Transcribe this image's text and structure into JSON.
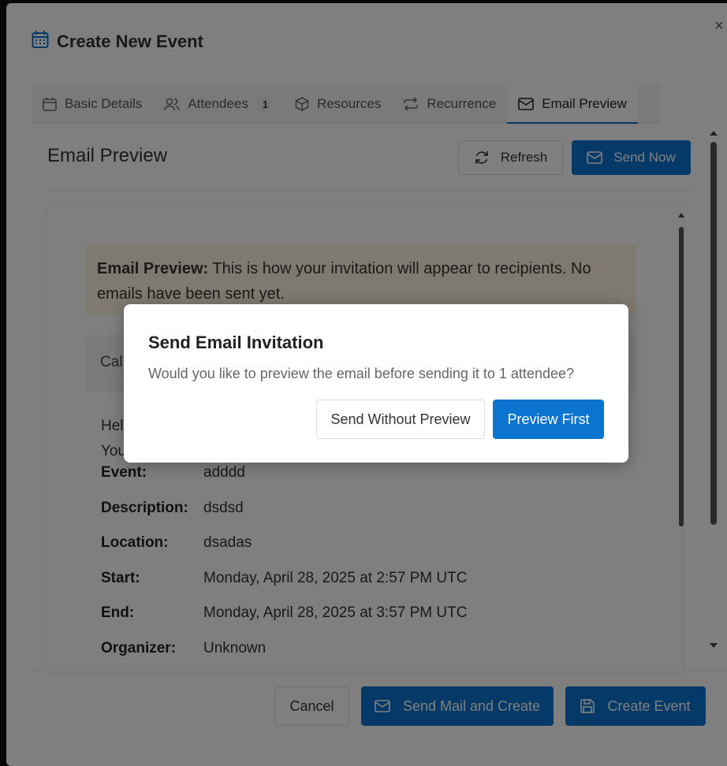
{
  "modal": {
    "title": "Create New Event",
    "close_label": "×"
  },
  "tabs": [
    {
      "label": "Basic Details",
      "icon": "calendar-icon"
    },
    {
      "label": "Attendees",
      "icon": "users-icon",
      "badge": "1"
    },
    {
      "label": "Resources",
      "icon": "box-icon"
    },
    {
      "label": "Recurrence",
      "icon": "repeat-icon"
    },
    {
      "label": "Email Preview",
      "icon": "mail-icon",
      "active": true
    }
  ],
  "preview": {
    "header": "Email Preview",
    "refresh_label": "Refresh",
    "send_now_label": "Send Now",
    "notice_bold": "Email Preview:",
    "notice_text": " This is how your invitation will appear to recipients. No emails have been sent yet.",
    "cal_text": "Cal",
    "hello_line1": "Hel",
    "hello_line2": "You"
  },
  "details": [
    {
      "label": "Event:",
      "value": "adddd"
    },
    {
      "label": "Description:",
      "value": "dsdsd"
    },
    {
      "label": "Location:",
      "value": "dsadas"
    },
    {
      "label": "Start:",
      "value": "Monday, April 28, 2025 at 2:57 PM UTC"
    },
    {
      "label": "End:",
      "value": "Monday, April 28, 2025 at 3:57 PM UTC"
    },
    {
      "label": "Organizer:",
      "value": "Unknown"
    }
  ],
  "footer": {
    "cancel_label": "Cancel",
    "send_mail_label": "Send Mail and Create",
    "create_label": "Create Event"
  },
  "dialog": {
    "title": "Send Email Invitation",
    "message": "Would you like to preview the email before sending it to 1 attendee?",
    "send_without_label": "Send Without Preview",
    "preview_first_label": "Preview First"
  },
  "colors": {
    "accent": "#0b74d1",
    "notice_bg": "#fdf4e1"
  }
}
